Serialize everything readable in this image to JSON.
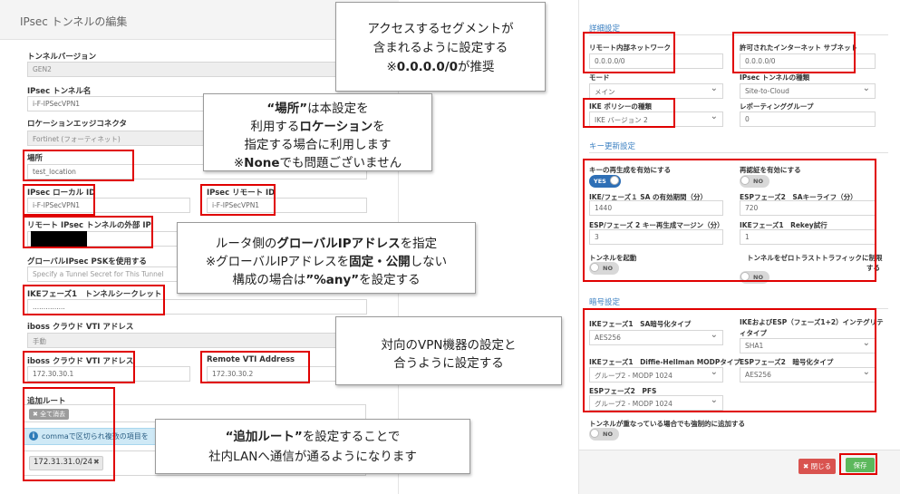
{
  "left": {
    "title": "IPsec トンネルの編集",
    "tunnel_version": {
      "label": "トンネルバージョン",
      "value": "GEN2"
    },
    "tunnel_name": {
      "label": "IPsec トンネル名",
      "value": "i-F-IPSecVPN1"
    },
    "location_edge": {
      "label": "ロケーションエッジコネクタ",
      "value": "Fortinet (フォーティネット)"
    },
    "location": {
      "label": "場所",
      "value": "test_location"
    },
    "local_id": {
      "label": "IPsec ローカル ID",
      "value": "i-F-IPSecVPN1"
    },
    "remote_id": {
      "label": "IPsec リモート ID",
      "value": "i-F-IPSecVPN1"
    },
    "remote_external_ip": {
      "label": "リモート IPsec トンネルの外部 IP"
    },
    "global_psk": {
      "label": "グローバルIPsec PSKを使用する",
      "placeholder": "Specify a Tunnel Secret for This Tunnel"
    },
    "ike1_secret": {
      "label": "IKEフェーズ1　トンネルシークレット",
      "value": "..............."
    },
    "cloud_vti_manual": {
      "label": "iboss クラウド VTI アドレス",
      "value": "手動"
    },
    "cloud_vti": {
      "label": "iboss クラウド VTI アドレス",
      "value": "172.30.30.1"
    },
    "remote_vti": {
      "label": "Remote VTI Address",
      "value": "172.30.30.2"
    },
    "routes": {
      "label": "追加ルート",
      "clear_all": "✖ 全て消去",
      "info": "commaで区切られ複数の項目を",
      "chip": "172.31.31.0/24",
      "chip_remove": "✖"
    }
  },
  "right": {
    "sec_detail": "詳細設定",
    "remote_internal_network": {
      "label": "リモート内部ネットワーク",
      "value": "0.0.0.0/0"
    },
    "allowed_internet_subnet": {
      "label": "許可されたインターネット サブネット",
      "value": "0.0.0.0/0"
    },
    "mode": {
      "label": "モード",
      "value": "メイン"
    },
    "tunnel_type": {
      "label": "IPsec トンネルの種類",
      "value": "Site-to-Cloud"
    },
    "ike_policy": {
      "label": "IKE ポリシーの種類",
      "value": "IKE バージョン 2"
    },
    "reporting_group": {
      "label": "レポーティンググループ",
      "value": "0"
    },
    "sec_rekey": "キー更新設定",
    "rekey_enable": {
      "label": "キーの再生成を有効にする",
      "state": "YES"
    },
    "reauth_enable": {
      "label": "再認証を有効にする",
      "state": "NO"
    },
    "ike1_lifetime": {
      "label": "IKE/フェーズ１ SA の有効期間（分）",
      "value": "1440"
    },
    "esp2_sa_life": {
      "label": "ESPフェーズ2　SAキーライフ（分）",
      "value": "720"
    },
    "esp2_rekey_margin": {
      "label": "ESP/フェーズ 2 キー再生成マージン（分）",
      "value": "3"
    },
    "ike1_rekey_retry": {
      "label": "IKEフェーズ1　Rekey試行",
      "value": "1"
    },
    "tunnel_start": {
      "label": "トンネルを起動",
      "state": "NO"
    },
    "zero_trust": {
      "label1": "トンネルをゼロトラストトラフィックに制限",
      "label2": "する",
      "state": "NO"
    },
    "sec_crypto": "暗号設定",
    "ike1_sa_encryption": {
      "label": "IKEフェーズ1　SA暗号化タイプ",
      "value": "AES256"
    },
    "integrity": {
      "label1": "IKEおよびESP（フェーズ1+2）インテグリテ",
      "label2": "ィタイプ",
      "value": "SHA1"
    },
    "dh_modp": {
      "label": "IKEフェーズ1　Diffie-Hellman MODPタイプ",
      "value": "グループ2 - MODP 1024"
    },
    "esp2_encryption": {
      "label": "ESPフェーズ2　暗号化タイプ",
      "value": "AES256"
    },
    "esp2_pfs": {
      "label": "ESPフェーズ2　PFS",
      "value": "グループ2 - MODP 1024"
    },
    "force_add": {
      "label": "トンネルが重なっている場合でも強制的に追加する",
      "state": "NO"
    },
    "close_button": "✖ 閉じる",
    "save_button": "保存"
  },
  "callouts": {
    "segment": {
      "l1": "アクセスするセグメントが",
      "l2": "含まれるように設定する",
      "l3a": "※",
      "l3b": "0.0.0.0/0",
      "l3c": "が推奨"
    },
    "location": {
      "l1a": "“場所”",
      "l1b": "は本設定を",
      "l2a": "利用する",
      "l2b": "ロケーション",
      "l2c": "を",
      "l3": "指定する場合に利用します",
      "l4a": "※",
      "l4b": "None",
      "l4c": "でも問題ございません"
    },
    "router": {
      "l1a": "ルータ側の",
      "l1b": "グローバルIPアドレス",
      "l1c": "を指定",
      "l2a": "※グローバルIPアドレスを",
      "l2b": "固定・公開",
      "l2c": "しない",
      "l3a": "構成の場合は",
      "l3b": "”%any”",
      "l3c": "を設定する"
    },
    "vpn": {
      "l1": "対向のVPN機器の設定と",
      "l2": "合うように設定する"
    },
    "routes": {
      "l1a": "“追加ルート”",
      "l1b": "を設定することで",
      "l2": "社内LANへ通信が通るようになります"
    }
  }
}
